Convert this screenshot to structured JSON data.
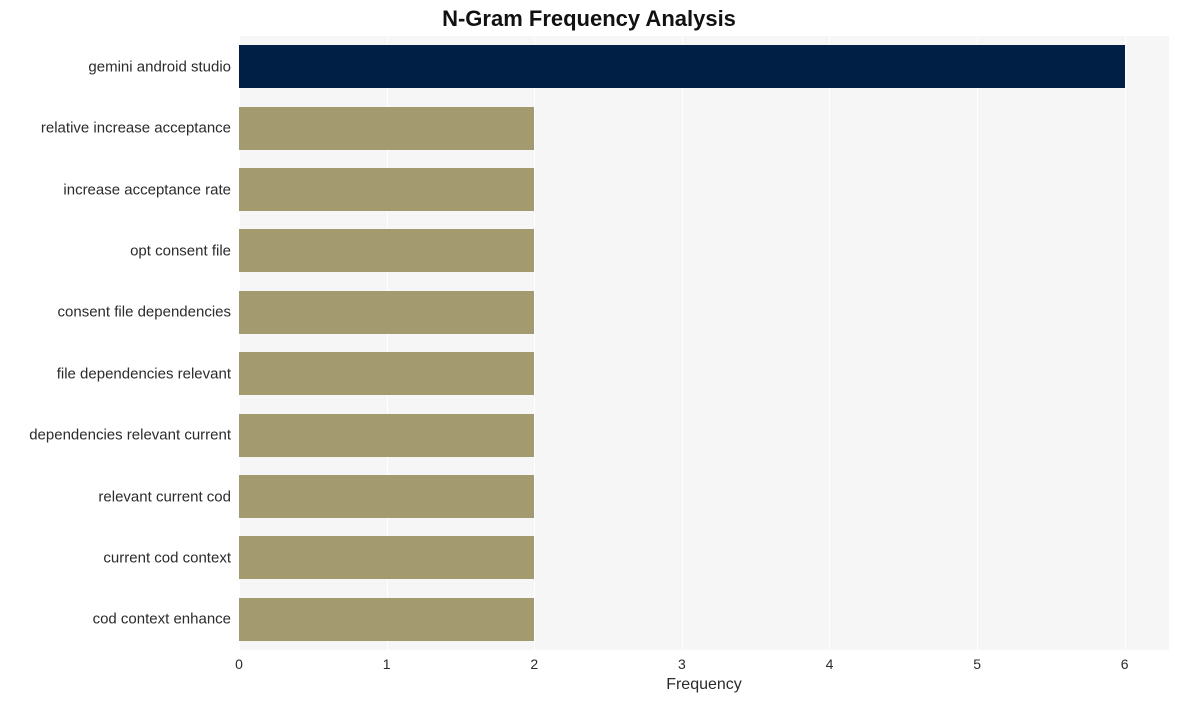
{
  "chart_data": {
    "type": "bar",
    "orientation": "horizontal",
    "title": "N-Gram Frequency Analysis",
    "xlabel": "Frequency",
    "ylabel": "",
    "xlim": [
      0,
      6.3
    ],
    "xticks": [
      0,
      1,
      2,
      3,
      4,
      5,
      6
    ],
    "categories": [
      "gemini android studio",
      "relative increase acceptance",
      "increase acceptance rate",
      "opt consent file",
      "consent file dependencies",
      "file dependencies relevant",
      "dependencies relevant current",
      "relevant current cod",
      "current cod context",
      "cod context enhance"
    ],
    "values": [
      6,
      2,
      2,
      2,
      2,
      2,
      2,
      2,
      2,
      2
    ],
    "colors": [
      "#001f45",
      "#a39a6f",
      "#a39a6f",
      "#a39a6f",
      "#a39a6f",
      "#a39a6f",
      "#a39a6f",
      "#a39a6f",
      "#a39a6f",
      "#a39a6f"
    ]
  }
}
